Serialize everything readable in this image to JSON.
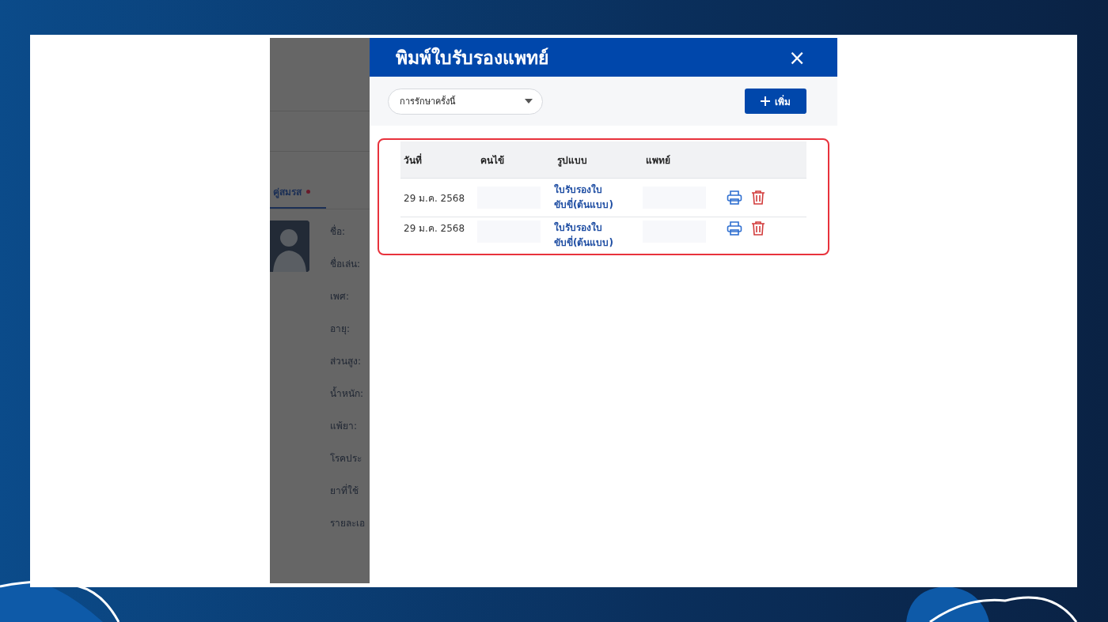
{
  "background_page": {
    "tab": {
      "label": "คู่สมรส",
      "selected": true
    },
    "fields": [
      "ชื่อ:",
      "ชื่อเล่น:",
      "เพศ:",
      "อายุ:",
      "ส่วนสูง:",
      "น้ำหนัก:",
      "แพ้ยา:",
      "โรคประ",
      "ยาที่ใช้",
      "รายละเอ"
    ]
  },
  "dialog": {
    "title": "พิมพ์ใบรับรองแพทย์",
    "close": "×",
    "filter": {
      "value": "การรักษาครั้งนี้"
    },
    "add_button": "เพิ่ม",
    "table": {
      "columns": [
        "วันที่",
        "คนไข้",
        "รูปแบบ",
        "แพทย์"
      ],
      "rows": [
        {
          "date": "29 ม.ค. 2568",
          "form": "ใบรับรองใบขับขี่(ต้นแบบ)"
        },
        {
          "date": "29 ม.ค. 2568",
          "form": "ใบรับรองใบขับขี่(ต้นแบบ)"
        }
      ]
    }
  }
}
